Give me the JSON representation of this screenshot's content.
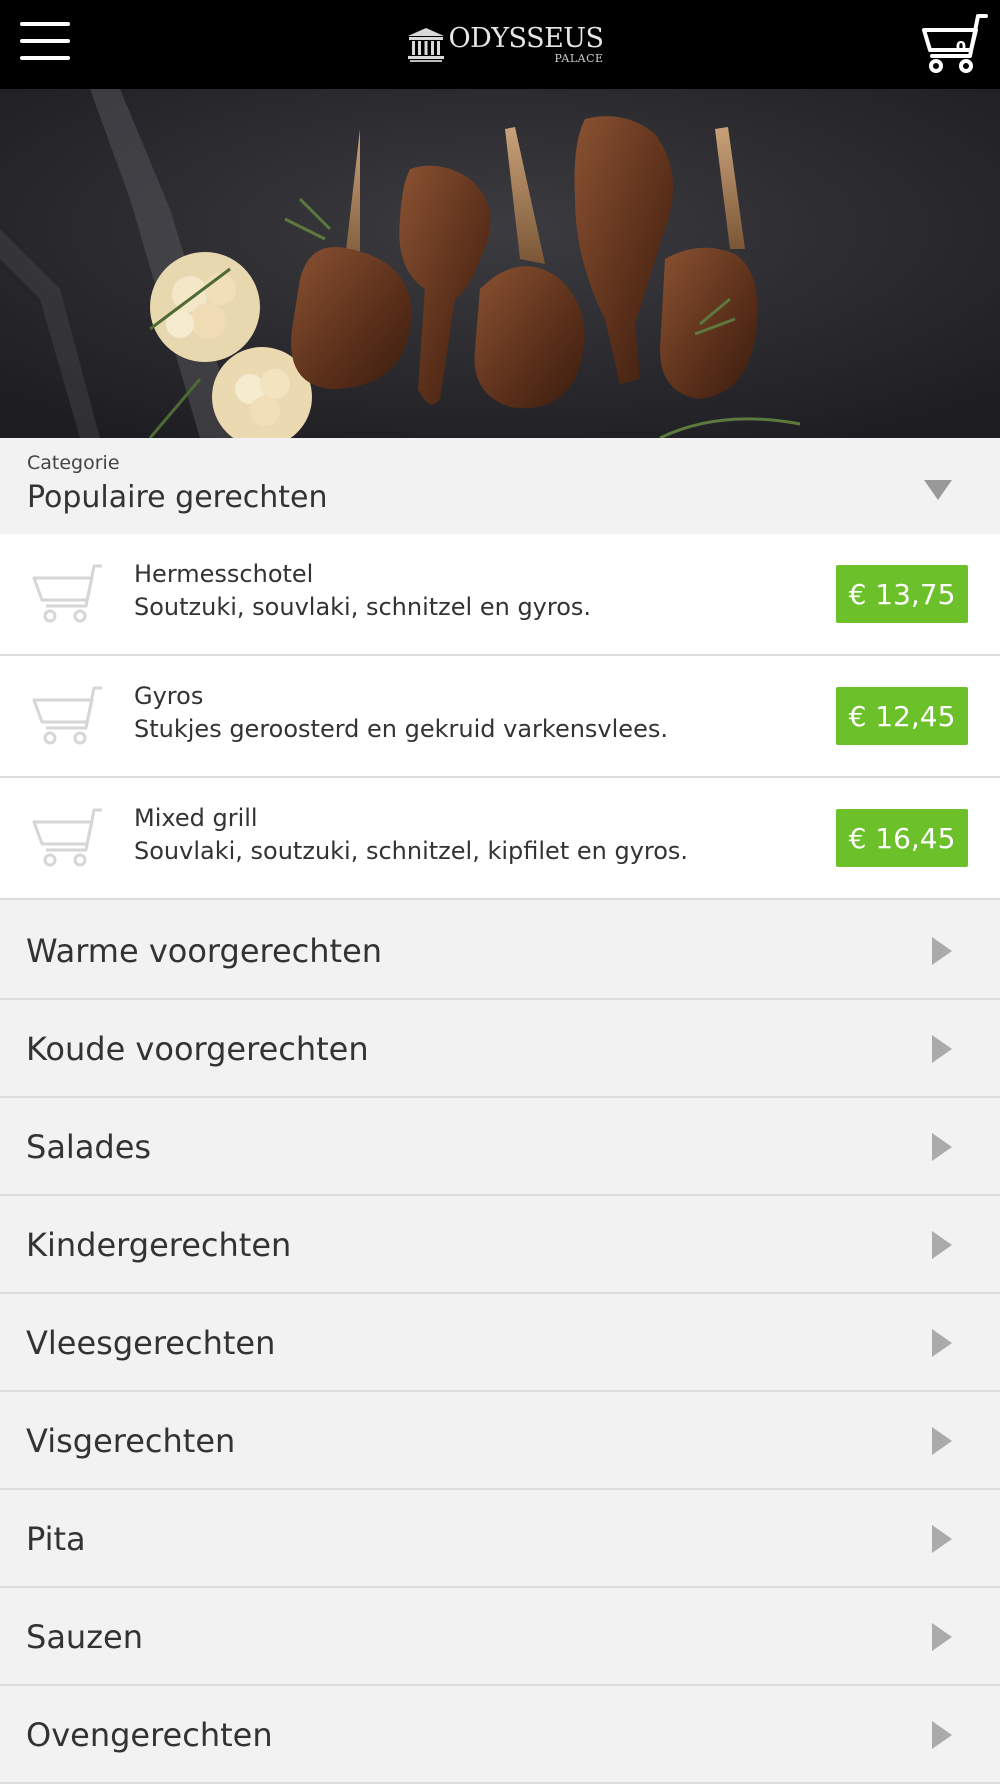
{
  "header": {
    "logo_main": "ODYSSEUS",
    "logo_sub": "PALACE",
    "cart_count": "0"
  },
  "category": {
    "label": "Categorie",
    "selected": "Populaire gerechten"
  },
  "items": [
    {
      "name": "Hermesschotel",
      "description": "Soutzuki, souvlaki, schnitzel en gyros.",
      "price": "€ 13,75"
    },
    {
      "name": "Gyros",
      "description": "Stukjes geroosterd en gekruid varkensvlees.",
      "price": "€ 12,45"
    },
    {
      "name": "Mixed grill",
      "description": "Souvlaki, soutzuki, schnitzel, kipfilet en gyros.",
      "price": "€ 16,45"
    }
  ],
  "categories": [
    "Warme voorgerechten",
    "Koude voorgerechten",
    "Salades",
    "Kindergerechten",
    "Vleesgerechten",
    "Visgerechten",
    "Pita",
    "Sauzen",
    "Ovengerechten"
  ],
  "colors": {
    "price_bg": "#6cc12a",
    "header_bg": "#000000",
    "list_bg": "#f2f2f2"
  }
}
